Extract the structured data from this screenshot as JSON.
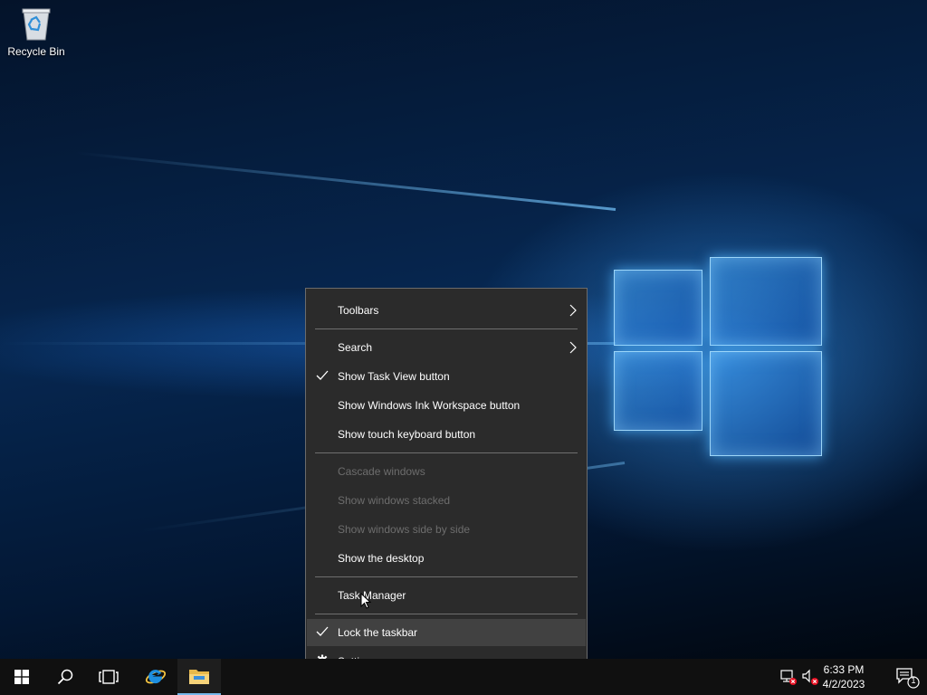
{
  "desktop": {
    "icons": [
      {
        "label": "Recycle Bin",
        "icon": "recycle-bin-icon"
      }
    ]
  },
  "context_menu": {
    "items": [
      {
        "label": "Toolbars",
        "submenu": true
      },
      {
        "label": "Search",
        "submenu": true
      },
      {
        "label": "Show Task View button",
        "checked": true
      },
      {
        "label": "Show Windows Ink Workspace button"
      },
      {
        "label": "Show touch keyboard button"
      },
      {
        "label": "Cascade windows",
        "disabled": true
      },
      {
        "label": "Show windows stacked",
        "disabled": true
      },
      {
        "label": "Show windows side by side",
        "disabled": true
      },
      {
        "label": "Show the desktop"
      },
      {
        "label": "Task Manager"
      },
      {
        "label": "Lock the taskbar",
        "checked": true,
        "highlighted": true
      },
      {
        "label": "Settings",
        "icon": "gear-icon"
      }
    ]
  },
  "taskbar": {
    "buttons": [
      {
        "name": "start",
        "icon": "windows-logo-icon"
      },
      {
        "name": "search",
        "icon": "search-icon"
      },
      {
        "name": "task-view",
        "icon": "task-view-icon"
      },
      {
        "name": "internet-explorer",
        "icon": "internet-explorer-icon"
      },
      {
        "name": "file-explorer",
        "icon": "folder-icon",
        "active": true
      }
    ],
    "tray": {
      "network_icon": "network-disconnected-icon",
      "volume_icon": "volume-muted-icon",
      "time": "6:33 PM",
      "date": "4/2/2023",
      "notification_count": "1"
    }
  },
  "colors": {
    "menu_bg": "#2b2b2b",
    "menu_highlight": "#414141",
    "taskbar_bg": "#101010",
    "accent": "#76b9ed"
  }
}
